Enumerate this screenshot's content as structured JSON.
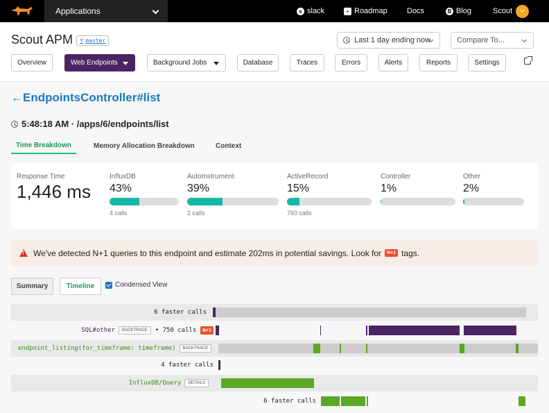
{
  "topbar": {
    "app_selector": "Applications",
    "links": [
      "slack",
      "Roadmap",
      "Docs",
      "Blog"
    ],
    "user": "Scout"
  },
  "header": {
    "app_name": "Scout APM",
    "branch": "master",
    "time_range": "Last 1 day ending now",
    "compare": "Compare To...",
    "nav": [
      "Overview",
      "Web Endpoints",
      "Background Jobs",
      "Database",
      "Traces",
      "Errors",
      "Alerts",
      "Reports",
      "Settings"
    ]
  },
  "endpoint": {
    "back_arrow": "←",
    "name": "EndpointsController#list",
    "trace_time": "5:48:18 AM · /apps/6/endpoints/list"
  },
  "tabs": [
    "Time Breakdown",
    "Memory Allocation Breakdown",
    "Context"
  ],
  "breakdown": {
    "response_label": "Response Time",
    "response_value": "1,446 ms",
    "metrics": [
      {
        "label": "InfluxDB",
        "pct": "43%",
        "fraction": 0.43,
        "calls": "4 calls"
      },
      {
        "label": "AutoInstrument",
        "pct": "39%",
        "fraction": 0.39,
        "calls": "2 calls"
      },
      {
        "label": "ActiveRecord",
        "pct": "15%",
        "fraction": 0.15,
        "calls": "760 calls"
      },
      {
        "label": "Controller",
        "pct": "1%",
        "fraction": 0.01,
        "calls": ""
      },
      {
        "label": "Other",
        "pct": "2%",
        "fraction": 0.02,
        "calls": ""
      }
    ]
  },
  "warning": {
    "text_before": "We've detected N+1 queries to this endpoint and estimate 202ms in potential savings. Look for",
    "badge": "N+1",
    "text_after": "tags."
  },
  "view": {
    "summary": "Summary",
    "timeline": "Timeline",
    "condensed": "Condensed View"
  },
  "timeline": {
    "rows": [
      {
        "label": "6 faster calls"
      },
      {
        "label": "SQL#other",
        "pill": "BACKTRACE",
        "calls": "• 750 calls",
        "badge": "N+1"
      },
      {
        "label": "endpoint_listing(for_timeframe: timeframe)",
        "pill": "BACKTRACE"
      },
      {
        "label": "4 faster calls"
      },
      {
        "label": "InfluxDB/Query",
        "pill": "DETAILS"
      },
      {
        "label": "6 faster calls"
      }
    ]
  },
  "colors": {
    "purple": "#4b2463",
    "green": "#5ca724",
    "teal": "#17b8a6",
    "gray": "#cccccc"
  }
}
